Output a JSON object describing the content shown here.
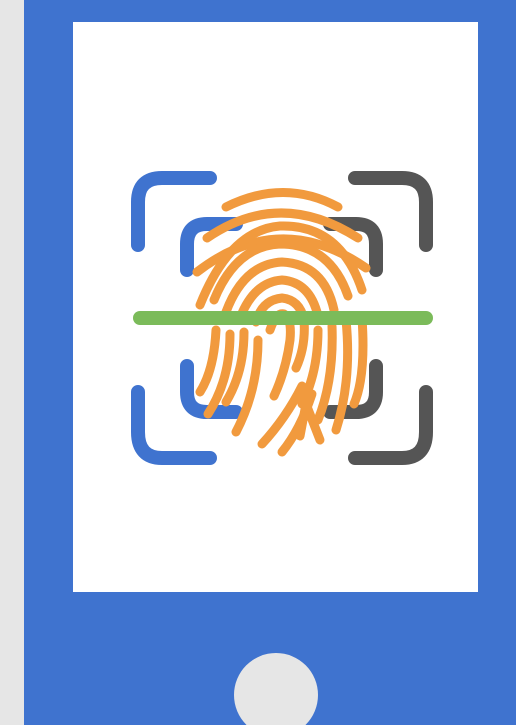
{
  "illustration": {
    "subject": "fingerprint-scan-on-phone",
    "icons": [
      "phone-icon",
      "fingerprint-icon",
      "scan-frame-icon",
      "scan-line-icon"
    ]
  },
  "colors": {
    "background": "#e6e6e6",
    "phone_body": "#3f73cf",
    "screen": "#ffffff",
    "home_button": "#e6e6e6",
    "fingerprint": "#f19a3e",
    "frame_blue": "#3f73cf",
    "frame_gray": "#555555",
    "scan_line": "#7bbb5a"
  }
}
